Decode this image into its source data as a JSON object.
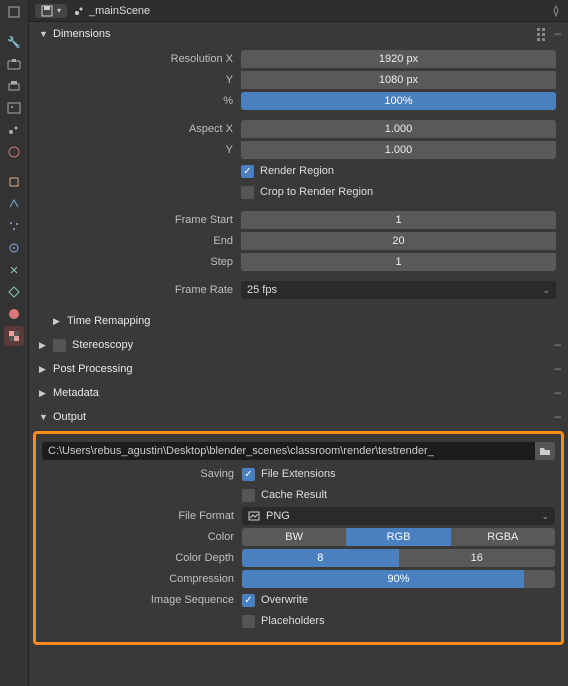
{
  "header": {
    "scene_name": "_mainScene"
  },
  "panels": {
    "dimensions": {
      "title": "Dimensions"
    },
    "time_remapping": {
      "title": "Time Remapping"
    },
    "stereoscopy": {
      "title": "Stereoscopy"
    },
    "post_processing": {
      "title": "Post Processing"
    },
    "metadata": {
      "title": "Metadata"
    },
    "output": {
      "title": "Output"
    }
  },
  "dimensions": {
    "labels": {
      "resolution_x": "Resolution X",
      "resolution_y": "Y",
      "percent": "%",
      "aspect_x": "Aspect X",
      "aspect_y": "Y",
      "frame_start": "Frame Start",
      "frame_end": "End",
      "frame_step": "Step",
      "frame_rate": "Frame Rate"
    },
    "values": {
      "resolution_x": "1920 px",
      "resolution_y": "1080 px",
      "percent": "100%",
      "percent_fill": 100,
      "aspect_x": "1.000",
      "aspect_y": "1.000",
      "frame_start": "1",
      "frame_end": "20",
      "frame_step": "1",
      "frame_rate": "25 fps"
    },
    "checks": {
      "render_region": "Render Region",
      "crop_render_region": "Crop to Render Region"
    }
  },
  "output": {
    "path": "C:\\Users\\rebus_agustin\\Desktop\\blender_scenes\\classroom\\render\\testrender_",
    "labels": {
      "saving": "Saving",
      "file_format": "File Format",
      "color": "Color",
      "color_depth": "Color Depth",
      "compression": "Compression",
      "image_sequence": "Image Sequence"
    },
    "checks": {
      "file_extensions": "File Extensions",
      "cache_result": "Cache Result",
      "overwrite": "Overwrite",
      "placeholders": "Placeholders"
    },
    "file_format": "PNG",
    "color_options": {
      "bw": "BW",
      "rgb": "RGB",
      "rgba": "RGBA"
    },
    "depth_options": {
      "d8": "8",
      "d16": "16"
    },
    "compression": {
      "value": "90%",
      "fill": 90
    }
  }
}
